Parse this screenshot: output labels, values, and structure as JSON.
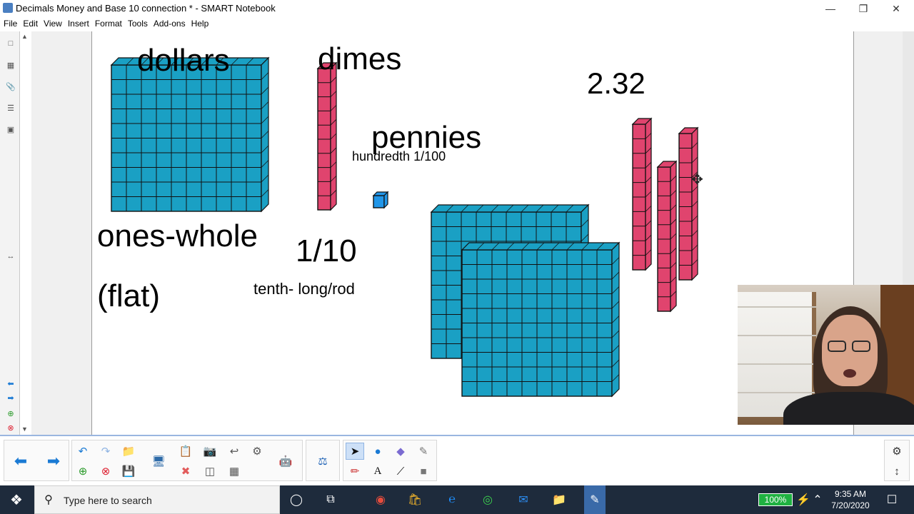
{
  "window": {
    "title": "Decimals Money and Base 10 connection * - SMART Notebook",
    "minimize_icon": "minimize-icon",
    "maximize_icon": "restore-icon",
    "close_icon": "close-icon"
  },
  "menu": [
    "File",
    "Edit",
    "View",
    "Insert",
    "Format",
    "Tools",
    "Add-ons",
    "Help"
  ],
  "canvas": {
    "dollars_label": "dollars",
    "dimes_label": "dimes",
    "pennies_label": "pennies",
    "hundredth_label": "hundredth 1/100",
    "ones_label": "ones-whole",
    "flat_label": "(flat)",
    "tenth_fraction": "1/10",
    "tenth_label": "tenth- long/rod",
    "amount": "2.32",
    "colors": {
      "flat": "#1aa0c4",
      "rod": "#e0446e",
      "unit": "#2196e8",
      "outline": "#111111"
    }
  },
  "toolbar": {
    "group1": [
      "back-arrow-icon",
      "forward-arrow-icon"
    ],
    "group2": [
      "undo-icon",
      "redo-icon",
      "open-folder-icon",
      "add-page-icon",
      "delete-page-icon",
      "save-icon",
      "screen-shade-icon",
      "paste-icon",
      "screen-capture-icon",
      "insert-icon",
      "full-screen-icon",
      "clear-icon",
      "table-icon",
      "measure-icon"
    ],
    "group3": [
      "add-ons-icon"
    ],
    "group4": [
      "select-icon",
      "shapes-icon",
      "eraser-icon",
      "magic-pen-icon",
      "pens-icon",
      "text-icon",
      "line-icon",
      "fill-icon"
    ],
    "right": [
      "settings-icon",
      "move-toolbar-icon"
    ]
  },
  "taskbar": {
    "search_placeholder": "Type here to search",
    "battery": "100%",
    "time": "9:35 AM",
    "date": "7/20/2020"
  }
}
